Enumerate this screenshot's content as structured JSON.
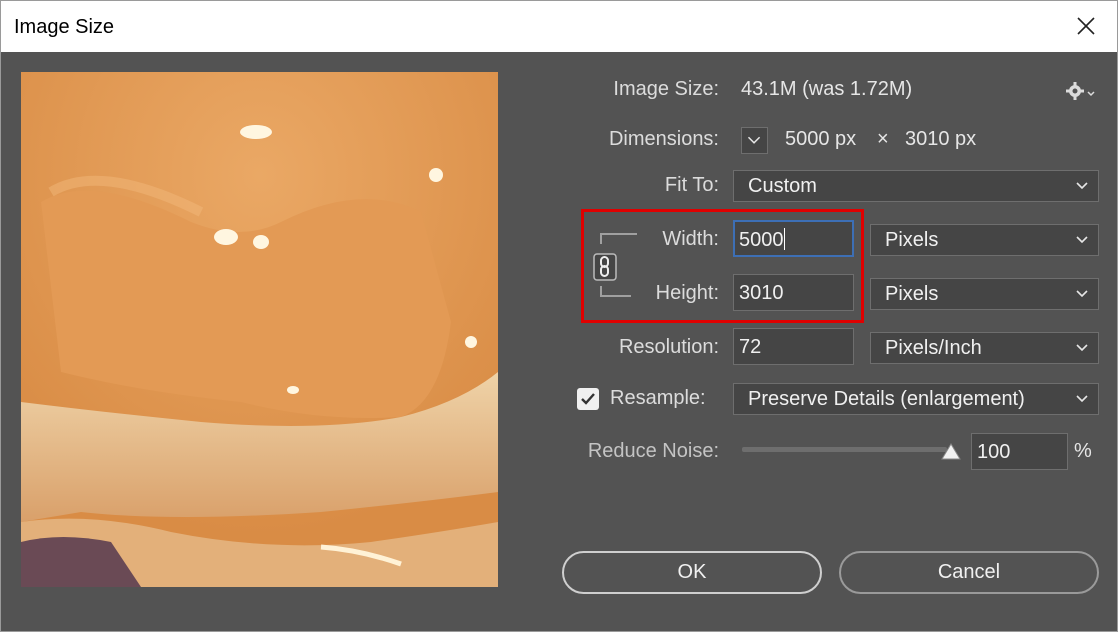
{
  "window": {
    "title": "Image Size"
  },
  "info": {
    "image_size_label": "Image Size:",
    "image_size_value": "43.1M (was 1.72M)",
    "dimensions_label": "Dimensions:",
    "dim_width": "5000 px",
    "dim_x": "×",
    "dim_height": "3010 px"
  },
  "fit_to": {
    "label": "Fit To:",
    "value": "Custom"
  },
  "width": {
    "label": "Width:",
    "value": "5000",
    "unit": "Pixels"
  },
  "height": {
    "label": "Height:",
    "value": "3010",
    "unit": "Pixels"
  },
  "resolution": {
    "label": "Resolution:",
    "value": "72",
    "unit": "Pixels/Inch"
  },
  "resample": {
    "label": "Resample:",
    "checked": true,
    "value": "Preserve Details (enlargement)"
  },
  "reduce_noise": {
    "label": "Reduce Noise:",
    "value": "100",
    "unit": "%",
    "level": 1.0
  },
  "buttons": {
    "ok": "OK",
    "cancel": "Cancel"
  },
  "colors": {
    "highlight_box": "#e00000",
    "focus_border": "#3d6fb5",
    "dialog_bg": "#535353"
  },
  "icons": [
    "close-icon",
    "gear-icon",
    "chevron-down-icon",
    "chain-link-icon",
    "checkmark-icon",
    "slider-thumb-icon"
  ]
}
